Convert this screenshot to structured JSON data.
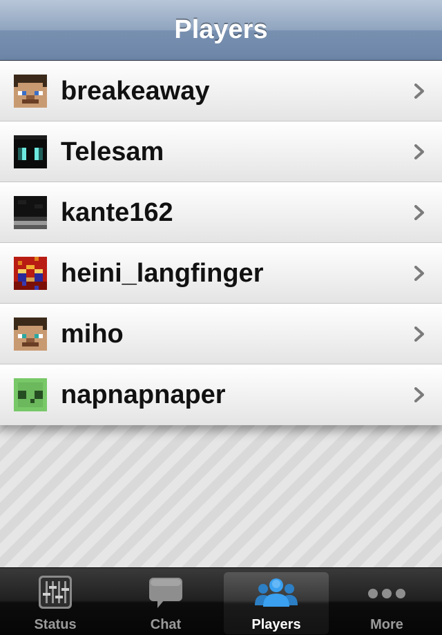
{
  "navbar": {
    "title": "Players"
  },
  "players": [
    {
      "name": "breakeaway",
      "avatar": "steve-face-blue-eyes-icon"
    },
    {
      "name": "Telesam",
      "avatar": "enderman-face-icon"
    },
    {
      "name": "kante162",
      "avatar": "dark-skin-face-icon"
    },
    {
      "name": "heini_langfinger",
      "avatar": "red-blue-skin-face-icon"
    },
    {
      "name": "miho",
      "avatar": "steve-face-teal-eyes-icon"
    },
    {
      "name": "napnapnaper",
      "avatar": "slime-face-icon"
    }
  ],
  "tabbar": {
    "tabs": [
      {
        "label": "Status",
        "icon": "sliders-icon",
        "active": false
      },
      {
        "label": "Chat",
        "icon": "speech-bubble-icon",
        "active": false
      },
      {
        "label": "Players",
        "icon": "people-icon",
        "active": true
      },
      {
        "label": "More",
        "icon": "more-dots-icon",
        "active": false
      }
    ]
  },
  "colors": {
    "navbar": "#7890b0",
    "tab_active_icon": "#3aa0ef",
    "tab_inactive": "#9a9a9a"
  }
}
